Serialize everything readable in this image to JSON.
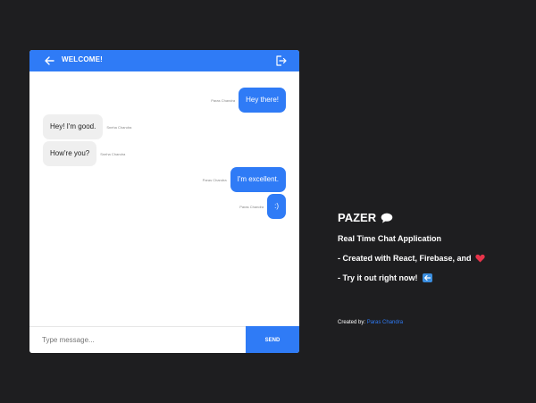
{
  "header": {
    "title": "WELCOME!",
    "back_icon": "arrow-left-icon",
    "logout_icon": "logout-icon"
  },
  "messages": [
    {
      "side": "right",
      "sender": "Paras Chandra",
      "text": "Hey there!"
    },
    {
      "side": "left",
      "sender": "Sneha Chandra",
      "text": "Hey! I'm good."
    },
    {
      "side": "left",
      "sender": "Sneha Chandra",
      "text": "How're you?"
    },
    {
      "side": "right",
      "sender": "Paras Chandra",
      "text": "I'm excellent."
    },
    {
      "side": "right",
      "sender": "Paras Chandra",
      "text": ":)"
    }
  ],
  "composer": {
    "placeholder": "Type message...",
    "send_label": "SEND"
  },
  "info": {
    "brand": "PAZER",
    "brand_icon": "speech-bubble-icon",
    "line1": "Real Time Chat Application",
    "line2": "- Created with React, Firebase, and",
    "line2_icon": "heart-icon",
    "line3": "- Try it out right now!",
    "line3_icon": "left-arrow-icon",
    "credit_prefix": "Created by:",
    "credit_name": "Paras Chandra"
  },
  "colors": {
    "accent": "#2f7bf6",
    "background": "#1e1e20",
    "received_bubble": "#efefef"
  }
}
